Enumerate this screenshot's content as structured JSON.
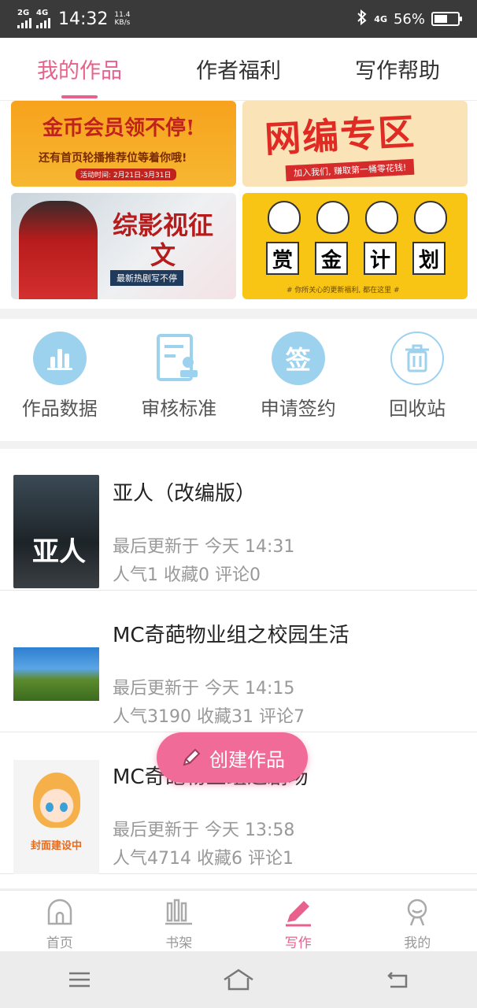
{
  "status_bar": {
    "net1": "2G",
    "net2": "4G",
    "time": "14:32",
    "speed_value": "11.4",
    "speed_unit": "KB/s",
    "net3": "4G",
    "battery": "56%",
    "battery_level": 0.56
  },
  "tabs": [
    {
      "label": "我的作品",
      "active": true
    },
    {
      "label": "作者福利",
      "active": false
    },
    {
      "label": "写作帮助",
      "active": false
    }
  ],
  "banners": {
    "b1": {
      "main": "金币会员领不停!",
      "sub": "还有首页轮播推荐位等着你哦!",
      "date": "活动时间: 2月21日-3月31日"
    },
    "b2": {
      "main": "网编专区",
      "strip": "加入我们, 赚取第一桶零花钱!"
    },
    "b3": {
      "main": "综影视征文",
      "strip": "最新热剧写不停"
    },
    "b4": {
      "words": [
        "赏",
        "金",
        "计",
        "划"
      ],
      "foot": "# 你所关心的更新福利, 都在这里 #"
    }
  },
  "actions": [
    {
      "label": "作品数据",
      "icon": "bar-chart-icon"
    },
    {
      "label": "审核标准",
      "icon": "review-doc-icon"
    },
    {
      "label": "申请签约",
      "icon": "sign-icon",
      "glyph": "签"
    },
    {
      "label": "回收站",
      "icon": "trash-icon"
    }
  ],
  "works": [
    {
      "title": "亚人（改编版）",
      "updated": "最后更新于 今天 14:31",
      "stats": "人气1 收藏0 评论0",
      "cover_text": "亚人"
    },
    {
      "title": "MC奇葩物业组之校园生活",
      "updated": "最后更新于 今天 14:15",
      "stats": "人气3190 收藏31 评论7"
    },
    {
      "title": "MC奇葩物业组之剧场",
      "updated": "最后更新于 今天 13:58",
      "stats": "人气4714 收藏6 评论1",
      "cover_text": "封面建设中"
    }
  ],
  "create_button": {
    "label": "创建作品",
    "color": "#f06b97"
  },
  "bottom_nav": [
    {
      "label": "首页",
      "icon": "home-icon",
      "active": false
    },
    {
      "label": "书架",
      "icon": "bookshelf-icon",
      "active": false
    },
    {
      "label": "写作",
      "icon": "pen-icon",
      "active": true
    },
    {
      "label": "我的",
      "icon": "profile-icon",
      "active": false
    }
  ],
  "colors": {
    "accent": "#e8618c",
    "icon_blue": "#9dd2ef"
  }
}
